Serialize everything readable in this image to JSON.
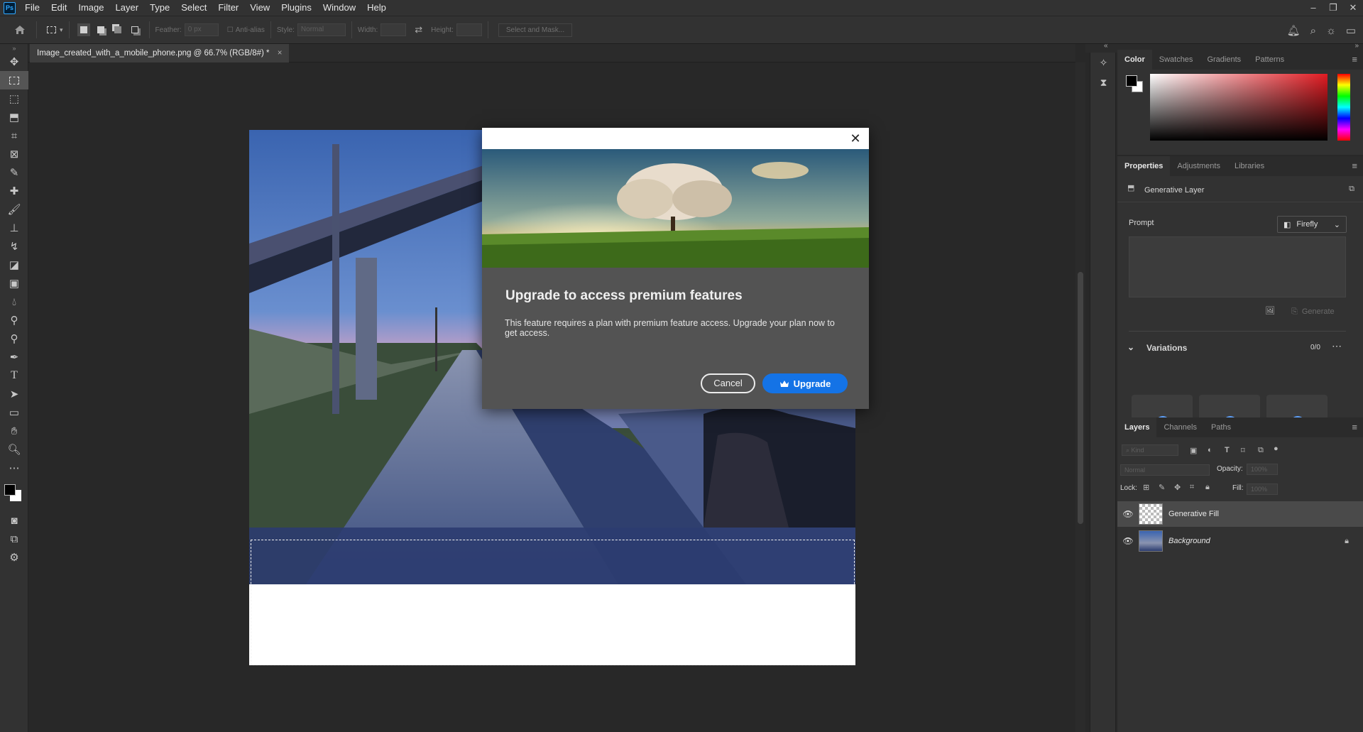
{
  "app": {
    "logo": "Ps"
  },
  "menu": [
    "File",
    "Edit",
    "Image",
    "Layer",
    "Type",
    "Select",
    "Filter",
    "View",
    "Plugins",
    "Window",
    "Help"
  ],
  "window_controls": [
    "–",
    "❐",
    "✕"
  ],
  "options": {
    "feather_label": "Feather:",
    "feather_value": "0 px",
    "antialias_label": "Anti-alias",
    "style_label": "Style:",
    "style_value": "Normal",
    "width_label": "Width:",
    "height_label": "Height:",
    "select_mask": "Select and Mask..."
  },
  "document": {
    "tab_title": "Image_created_with_a_mobile_phone.png @ 66.7% (RGB/8#) *",
    "close": "×"
  },
  "modal": {
    "title": "Upgrade to access premium features",
    "body": "This feature requires a plan with premium feature access. Upgrade your plan now to get access.",
    "cancel": "Cancel",
    "upgrade": "Upgrade",
    "close": "✕"
  },
  "color_panel": {
    "tabs": [
      "Color",
      "Swatches",
      "Gradients",
      "Patterns"
    ],
    "fg": "#000000",
    "bg": "#ffffff",
    "hue_color": "#e11b22"
  },
  "properties_panel": {
    "tabs": [
      "Properties",
      "Adjustments",
      "Libraries"
    ],
    "layer_type": "Generative Layer",
    "prompt_label": "Prompt",
    "model": "Firefly",
    "generate": "Generate",
    "variations_label": "Variations",
    "variations_count": "0/0"
  },
  "layers_panel": {
    "tabs": [
      "Layers",
      "Channels",
      "Paths"
    ],
    "kind_placeholder": "Kind",
    "blend_mode": "Normal",
    "opacity_label": "Opacity:",
    "opacity_value": "100%",
    "lock_label": "Lock:",
    "fill_label": "Fill:",
    "fill_value": "100%",
    "layers": [
      {
        "name": "Generative Fill",
        "selected": true
      },
      {
        "name": "Background",
        "locked": true
      }
    ]
  }
}
